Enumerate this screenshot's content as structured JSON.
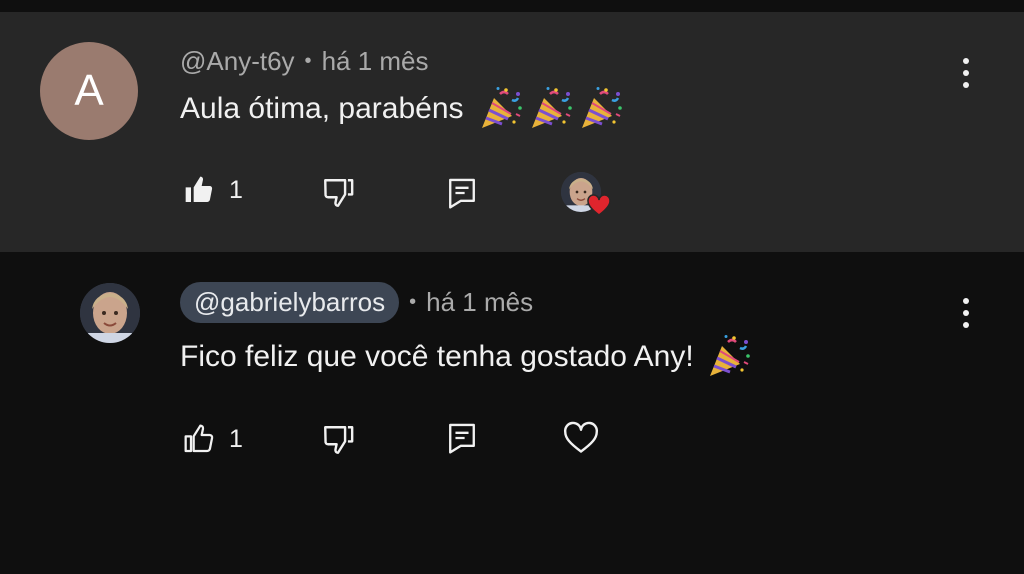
{
  "top_comment": {
    "avatar_letter": "A",
    "author": "@Any-t6y",
    "separator": "•",
    "time": "há 1 mês",
    "text": "Aula ótima,  parabéns",
    "emoji_name": "party-popper",
    "like_count": "1"
  },
  "reply": {
    "author": "@gabrielybarros",
    "separator": "•",
    "time": "há 1 mês",
    "text": "Fico feliz que você tenha gostado Any!",
    "emoji_name": "party-popper",
    "like_count": "1"
  },
  "colors": {
    "top_background": "#272727",
    "reply_background": "#0f0f0f",
    "heart_red": "#e0252d",
    "avatar_letter_bg": "#9a7b6f",
    "handle_pill_bg": "#3d4654"
  }
}
